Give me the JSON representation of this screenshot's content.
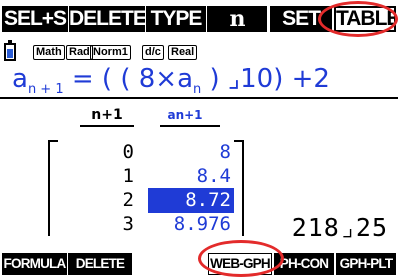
{
  "top_function_keys": [
    "SEL+S",
    "DELETE",
    "TYPE",
    "n",
    "SET",
    "TABLE"
  ],
  "status_bar": {
    "angle_mode": "Math",
    "unit": "Rad",
    "display": "Norm1",
    "fraction": "d/c",
    "number_type": "Real"
  },
  "recursion": {
    "lhs": "a",
    "lhs_sub": "n + 1",
    "rhs_open": " = ( ( 8×a",
    "rhs_sub": "n",
    "rhs_close": " ) ⌟10) +2"
  },
  "table": {
    "headers": {
      "n": "n+1",
      "a": "an+1"
    },
    "rows": [
      {
        "n": "0",
        "a": "8"
      },
      {
        "n": "1",
        "a": "8.4"
      },
      {
        "n": "2",
        "a": "8.72"
      },
      {
        "n": "3",
        "a": "8.976"
      }
    ],
    "selected_row": 2
  },
  "result_value": "218⌟25",
  "bottom_function_keys": [
    "FORMULA",
    "DELETE",
    "",
    "",
    "WEB-GPH",
    "PH-CON",
    "GPH-PLT"
  ],
  "colors": {
    "accent": "#1f3bd6",
    "highlight": "#e32b2b"
  }
}
